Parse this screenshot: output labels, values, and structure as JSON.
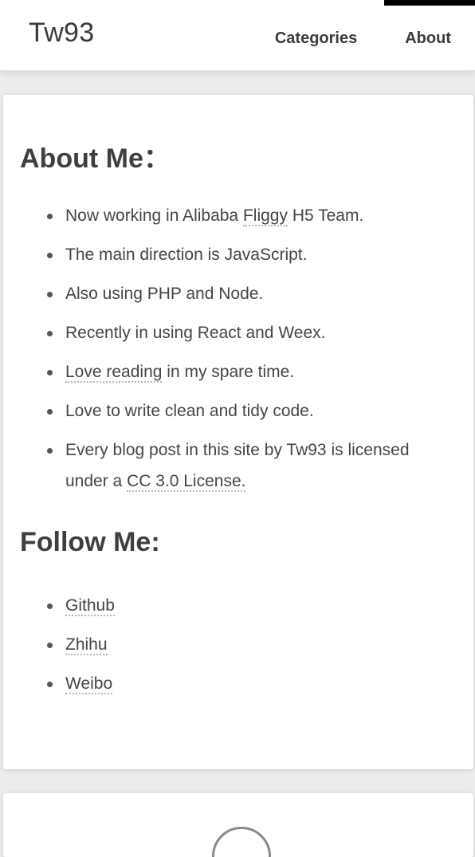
{
  "header": {
    "brand": "Tw93",
    "nav": [
      {
        "label": "Categories"
      },
      {
        "label": "About"
      }
    ]
  },
  "about": {
    "title": "About Me：",
    "items": [
      {
        "before": "Now working in Alibaba ",
        "link": "Fliggy",
        "after": " H5 Team."
      },
      {
        "text": "The main direction is JavaScript."
      },
      {
        "text": "Also using PHP and Node."
      },
      {
        "text": "Recently in using React and Weex."
      },
      {
        "link": "Love reading",
        "after": " in my spare time."
      },
      {
        "text": "Love to write clean and tidy code."
      },
      {
        "before": "Every blog post in this site by Tw93 is licensed under a ",
        "link": "CC 3.0 License."
      }
    ]
  },
  "follow": {
    "title": "Follow Me:",
    "links": [
      {
        "label": "Github"
      },
      {
        "label": "Zhihu"
      },
      {
        "label": "Weibo"
      }
    ]
  }
}
